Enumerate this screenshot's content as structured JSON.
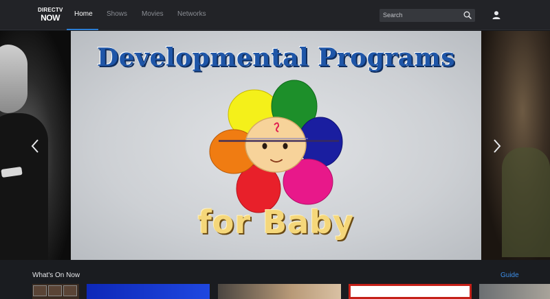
{
  "header": {
    "logo": {
      "line1": "DIRECTV",
      "line2": "NOW"
    },
    "tabs": [
      {
        "label": "Home",
        "active": true
      },
      {
        "label": "Shows",
        "active": false
      },
      {
        "label": "Movies",
        "active": false
      },
      {
        "label": "Networks",
        "active": false
      }
    ],
    "search": {
      "placeholder": "Search"
    },
    "accent_color": "#2d7fd6"
  },
  "hero": {
    "poster_title": "Developmental Programs",
    "poster_subtitle": "for Baby",
    "prev_icon": "chevron-left-icon",
    "next_icon": "chevron-right-icon"
  },
  "row": {
    "title": "What's On Now",
    "guide_label": "Guide",
    "link_color": "#3d8ee8"
  }
}
